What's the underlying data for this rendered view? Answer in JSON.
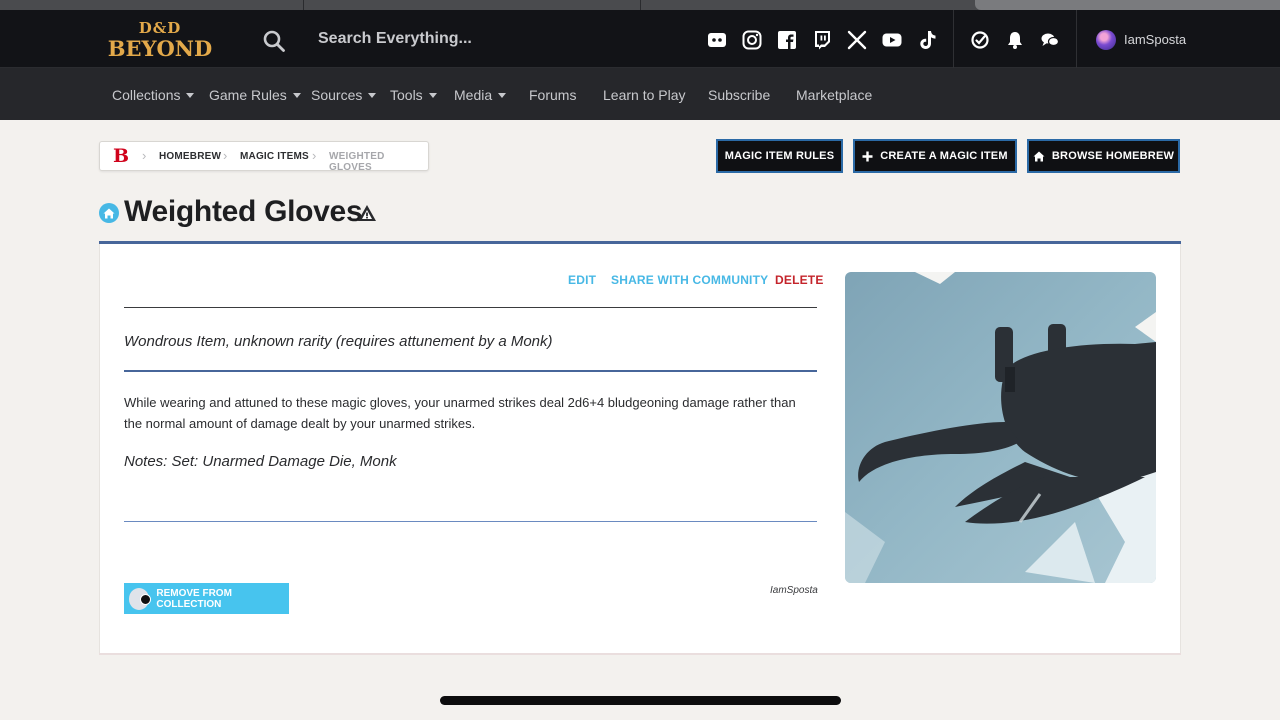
{
  "header": {
    "logo_line1": "D&D",
    "logo_line2": "BEYOND",
    "search_placeholder": "Search Everything...",
    "social_icons": [
      "discord-icon",
      "instagram-icon",
      "facebook-icon",
      "twitch-icon",
      "x-icon",
      "youtube-icon",
      "tiktok-icon"
    ],
    "utility_icons": [
      "dice-icon",
      "bell-icon",
      "chat-icon"
    ],
    "username": "IamSposta"
  },
  "nav": {
    "items": [
      {
        "label": "Collections",
        "dropdown": true
      },
      {
        "label": "Game Rules",
        "dropdown": true
      },
      {
        "label": "Sources",
        "dropdown": true
      },
      {
        "label": "Tools",
        "dropdown": true
      },
      {
        "label": "Media",
        "dropdown": true
      },
      {
        "label": "Forums",
        "dropdown": false
      },
      {
        "label": "Learn to Play",
        "dropdown": false
      },
      {
        "label": "Subscribe",
        "dropdown": false
      },
      {
        "label": "Marketplace",
        "dropdown": false
      }
    ]
  },
  "breadcrumb": {
    "home_glyph": "B",
    "items": [
      "HOMEBREW",
      "MAGIC ITEMS",
      "WEIGHTED GLOVES"
    ]
  },
  "actions": {
    "magic_item_rules": "MAGIC ITEM RULES",
    "create_magic_item": "CREATE A MAGIC ITEM",
    "browse_homebrew": "BROWSE HOMEBREW"
  },
  "item": {
    "title": "Weighted Gloves",
    "links": {
      "edit": "EDIT",
      "share": "SHARE WITH COMMUNITY",
      "delete": "DELETE"
    },
    "rarity": "Wondrous Item, unknown rarity (requires attunement by a Monk)",
    "description": "While wearing and attuned to these magic gloves, your unarmed strikes deal 2d6+4 bludgeoning damage rather than the normal amount of damage dealt by your unarmed strikes.",
    "notes": "Notes: Set: Unarmed Damage Die, Monk",
    "remove_button": "REMOVE FROM COLLECTION",
    "author": "IamSposta"
  },
  "colors": {
    "header_bg": "#121317",
    "nav_bg": "#26272b",
    "accent_blue": "#47c4ee",
    "link_blue": "#47b8e5",
    "delete_red": "#c4242b",
    "rule_blue": "#47669a",
    "logo_gold": "#e3a94a"
  }
}
